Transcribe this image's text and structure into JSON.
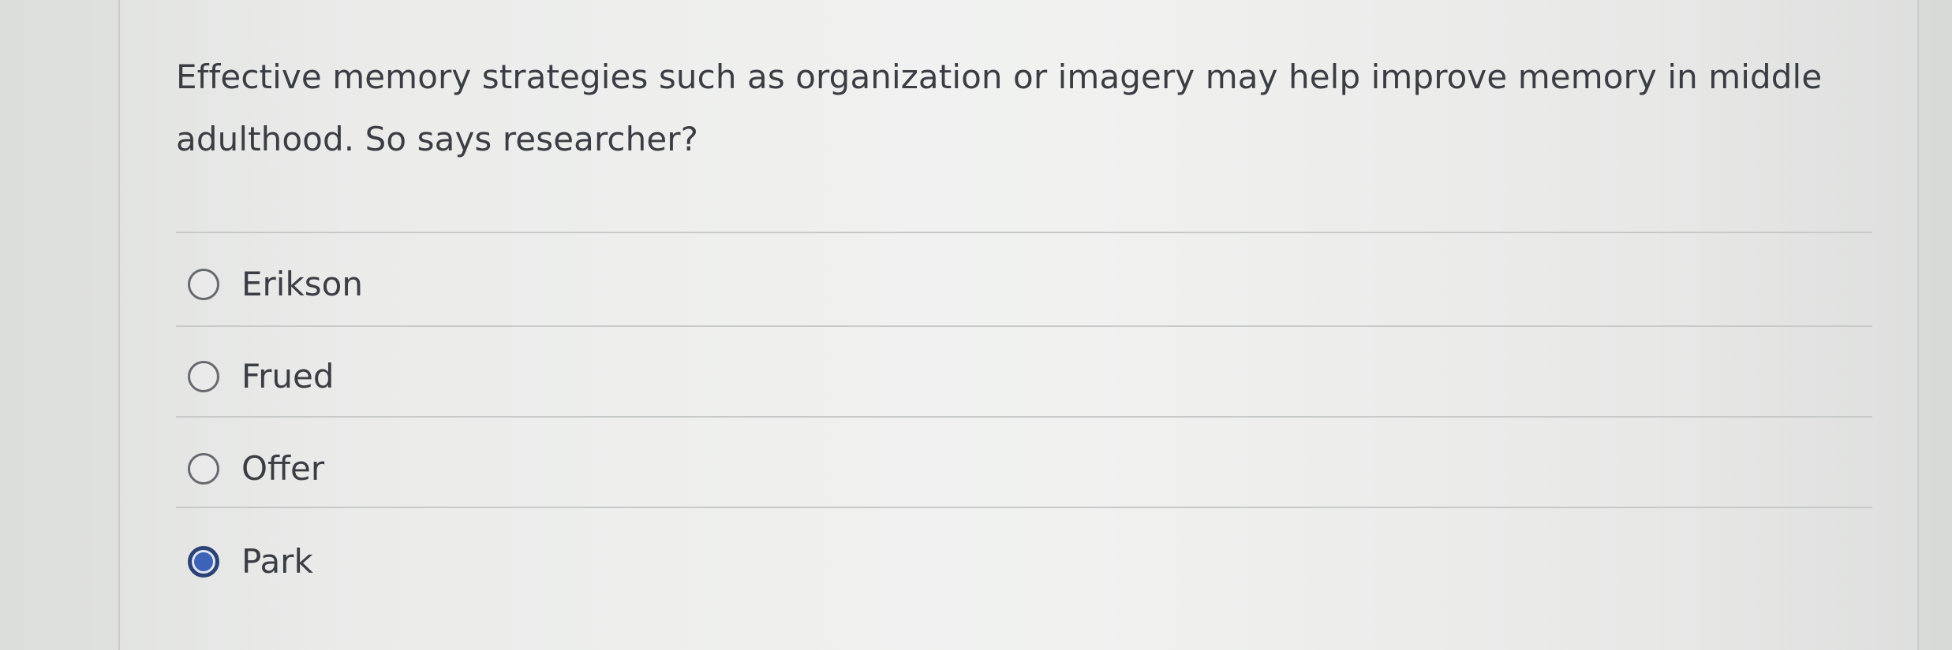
{
  "question": {
    "text": "Effective memory strategies such as organization or imagery may help improve memory in middle adulthood.  So says researcher?"
  },
  "options": [
    {
      "label": "Erikson",
      "selected": false
    },
    {
      "label": "Frued",
      "selected": false
    },
    {
      "label": "Offer",
      "selected": false
    },
    {
      "label": "Park",
      "selected": true
    }
  ],
  "colors": {
    "selected_radio": "#3c63b8",
    "selected_ring": "#2b4276",
    "text": "#3a3e44"
  }
}
